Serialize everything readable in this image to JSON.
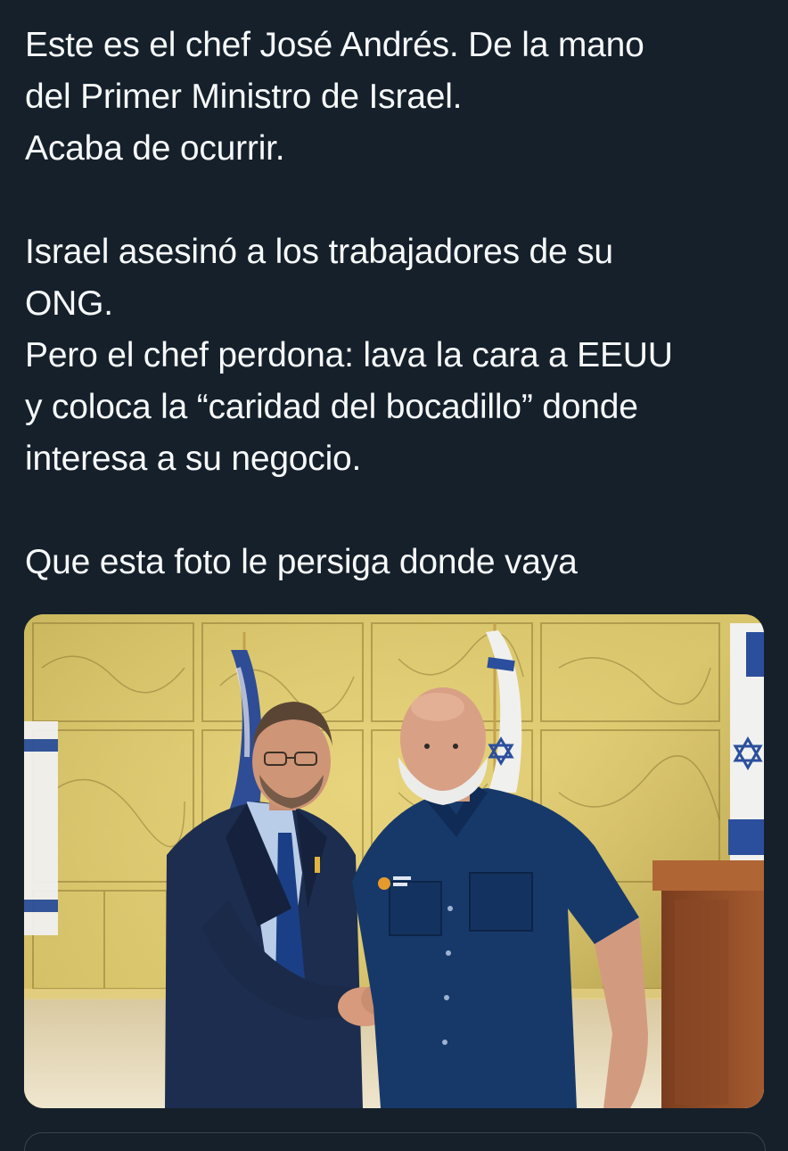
{
  "tweet": {
    "lines": [
      "Este es el chef José Andrés. De la mano",
      "del Primer Ministro de Israel.",
      "Acaba de ocurrir.",
      "",
      "Israel asesinó a los trabajadores de su",
      "ONG.",
      "Pero el chef perdona: lava la cara a EEUU",
      "y coloca la “caridad del bocadillo” donde",
      "interesa a su negocio.",
      "",
      "Que esta foto le persiga donde vaya"
    ]
  },
  "theme": {
    "background": "#15202b",
    "text": "#f7f9f9",
    "border": "#38444d"
  }
}
